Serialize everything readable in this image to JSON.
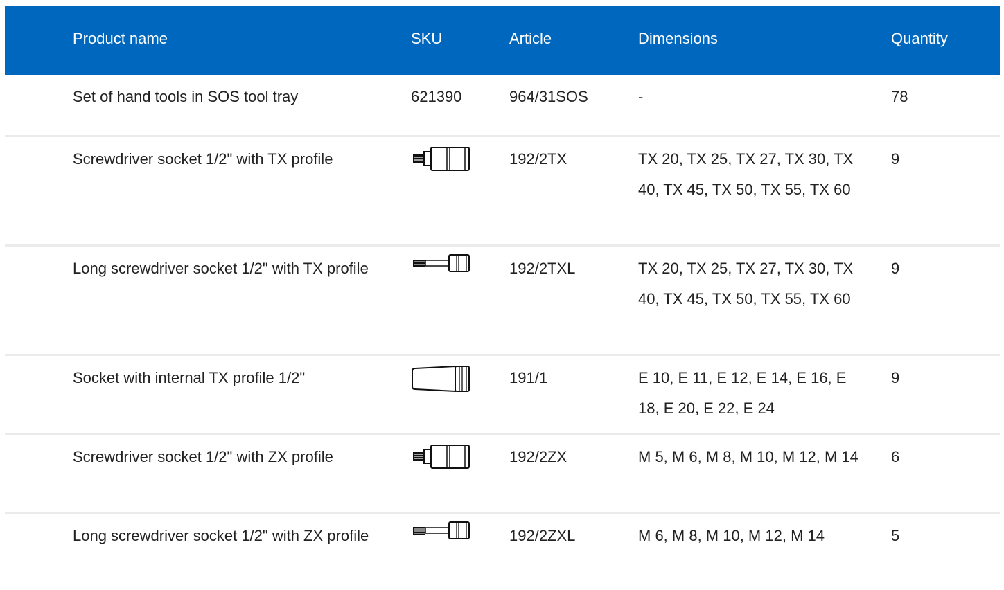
{
  "columns": {
    "name": "Product name",
    "sku": "SKU",
    "article": "Article",
    "dimensions": "Dimensions",
    "quantity": "Quantity"
  },
  "rows": [
    {
      "name": "Set of hand tools in SOS tool tray",
      "sku": "621390",
      "sku_icon": null,
      "article": "964/31SOS",
      "dimensions": "-",
      "quantity": "78"
    },
    {
      "name": "Screwdriver socket 1/2\" with TX profile",
      "sku": "",
      "sku_icon": "tx-screwdriver-socket-icon",
      "article": "192/2TX",
      "dimensions": "TX 20, TX 25, TX 27, TX 30, TX 40, TX 45, TX 50, TX 55, TX 60",
      "quantity": "9"
    },
    {
      "name": "Long screwdriver socket 1/2\" with TX profile",
      "sku": "",
      "sku_icon": "long-tx-screwdriver-socket-icon",
      "article": "192/2TXL",
      "dimensions": "TX 20, TX 25, TX 27, TX 30, TX 40, TX 45, TX 50, TX 55, TX 60",
      "quantity": "9"
    },
    {
      "name": "Socket with internal TX profile 1/2\"",
      "sku": "",
      "sku_icon": "internal-tx-socket-icon",
      "article": "191/1",
      "dimensions": "E 10, E 11, E 12, E 14, E 16, E 18, E 20, E 22, E 24",
      "quantity": "9"
    },
    {
      "name": "Screwdriver socket 1/2\" with ZX profile",
      "sku": "",
      "sku_icon": "zx-screwdriver-socket-icon",
      "article": "192/2ZX",
      "dimensions": "M 5, M 6, M 8, M 10, M 12, M 14",
      "quantity": "6"
    },
    {
      "name": "Long screwdriver socket 1/2\" with ZX profile",
      "sku": "",
      "sku_icon": "long-zx-screwdriver-socket-icon",
      "article": "192/2ZXL",
      "dimensions": "M 6, M 8, M 10, M 12, M 14",
      "quantity": "5"
    }
  ],
  "colors": {
    "header_bg": "#0067be",
    "header_text": "#ffffff",
    "row_divider": "#ebebeb",
    "body_text": "#222222"
  }
}
